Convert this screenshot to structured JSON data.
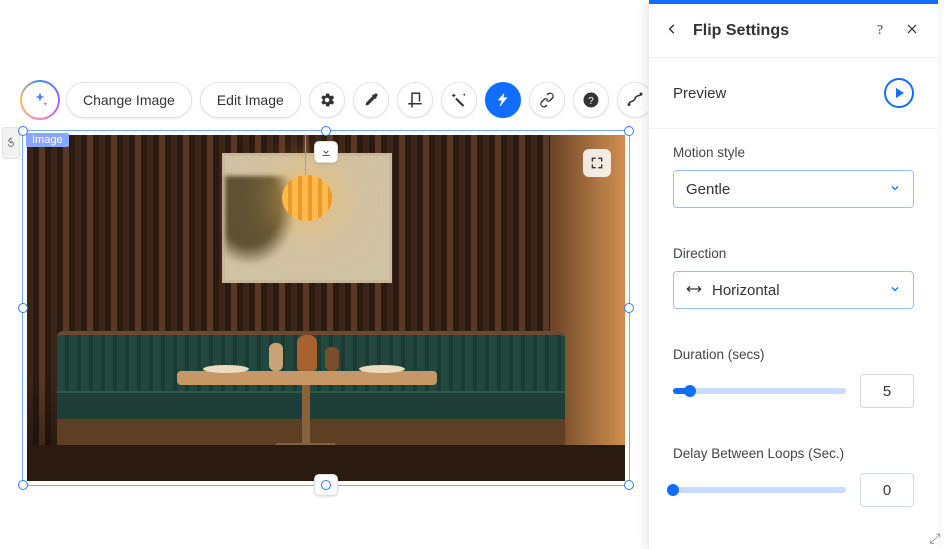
{
  "toolbar": {
    "change_image": "Change Image",
    "edit_image": "Edit Image"
  },
  "canvas": {
    "tag": "Image"
  },
  "panel": {
    "title": "Flip Settings",
    "preview": "Preview",
    "motion_label": "Motion style",
    "motion_value": "Gentle",
    "direction_label": "Direction",
    "direction_value": "Horizontal",
    "duration_label": "Duration (secs)",
    "duration_value": "5",
    "duration_fill_pct": "10%",
    "delay_label": "Delay Between Loops (Sec.)",
    "delay_value": "0",
    "delay_fill_pct": "0%"
  }
}
